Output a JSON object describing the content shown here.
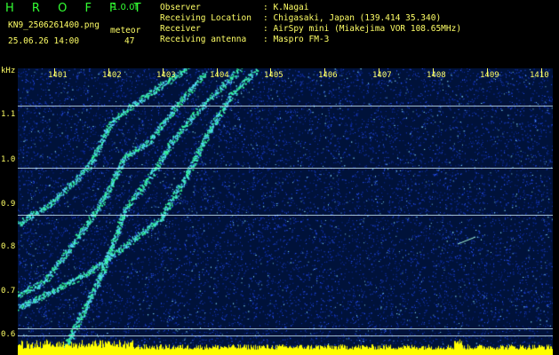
{
  "header": {
    "logo": "H R O F F T",
    "version": "1.0.0f",
    "file_name": "KN9_2506261400.png",
    "datetime": "25.06.26 14:00",
    "meteor_label": "meteor",
    "meteor_count": "47",
    "info": [
      {
        "label": "Observer",
        "value": ": K.Nagai"
      },
      {
        "label": "Receiving Location",
        "value": ": Chigasaki, Japan (139.414 35.340)"
      },
      {
        "label": "Receiver",
        "value": ": AirSpy mini (Miakejima VOR 108.65MHz)"
      },
      {
        "label": "Receiving antenna",
        "value": ": Maspro FM-3"
      }
    ]
  },
  "chart_data": {
    "type": "heatmap",
    "ylabel": "kHz",
    "y_ticks": [
      "1.1",
      "1.0",
      "0.9",
      "0.8",
      "0.7",
      "0.6"
    ],
    "x_ticks": [
      "1401",
      "1402",
      "1403",
      "1404",
      "1405",
      "1406",
      "1407",
      "1408",
      "1409",
      "1410"
    ],
    "ylim": [
      0.58,
      1.18
    ],
    "grid": false,
    "reference_lines_khz": [
      1.115,
      0.985,
      0.878,
      0.62,
      0.602
    ],
    "colors": {
      "background": "#00123a",
      "noise": "#2244ff",
      "signal": "#33ff99",
      "amplitude": "#ffff00",
      "text": "#ffff66"
    }
  }
}
